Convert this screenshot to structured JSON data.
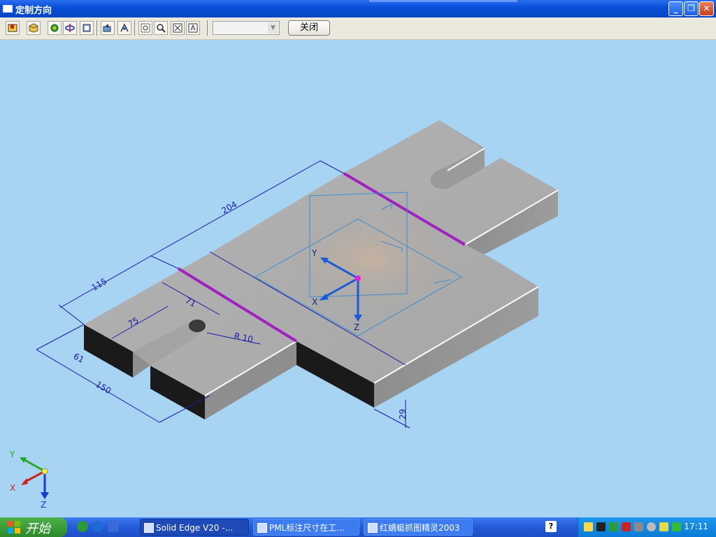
{
  "window": {
    "title": "定制方向"
  },
  "toolbar": {
    "buttons": [
      "save-view-icon",
      "isometric-view-icon",
      "rotate-icon",
      "spin-icon",
      "fit-part-icon",
      "previous-view-icon",
      "named-view-icon",
      "zoom-area-icon",
      "zoom-icon",
      "fit-icon",
      "pan-icon"
    ],
    "combo_value": "",
    "close_label": "关闭"
  },
  "model": {
    "dimensions": {
      "d204": "204",
      "d115": "115",
      "d71": "71",
      "d75": "75",
      "d61": "61",
      "d150": "150",
      "r10": "R 10",
      "d29": "29"
    },
    "axis_labels": {
      "y": "Y",
      "x": "X",
      "z": "Z"
    }
  },
  "triad": {
    "y": "Y",
    "x": "X",
    "z": "Z"
  },
  "colors": {
    "viewport": "#a6d4f2",
    "dimension_line": "#1a1aa8",
    "selected_edge": "#a020c0",
    "plane": "#3a8fd0",
    "origin": "#e020e0"
  },
  "taskbar": {
    "start_label": "开始",
    "tasks": [
      "Solid Edge V20 -...",
      "PML标注尺寸在工...",
      "红蜻蜓抓图精灵2003"
    ],
    "clock": "17:11"
  }
}
